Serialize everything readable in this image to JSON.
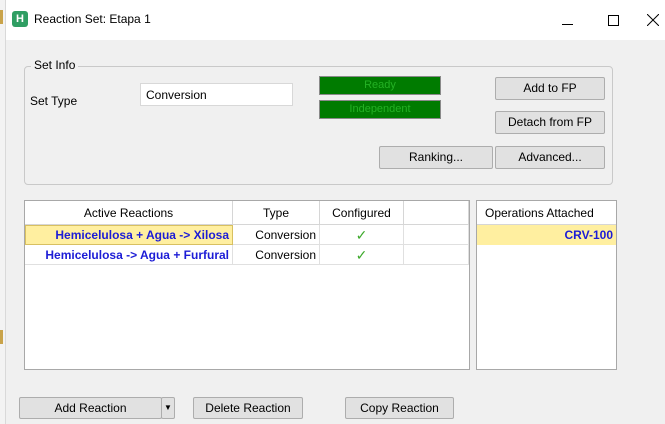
{
  "window": {
    "title": "Reaction Set: Etapa 1",
    "icon": "hysys-app-icon",
    "icon_letter": "H",
    "controls": [
      "minimize-icon",
      "maximize-icon",
      "close-icon"
    ]
  },
  "set_info": {
    "group_label": "Set Info",
    "set_type_label": "Set Type",
    "set_type_value": "Conversion",
    "status_ready": "Ready",
    "status_independent": "Independent",
    "buttons": {
      "add_to_fp": "Add to FP",
      "detach_from_fp": "Detach from FP",
      "ranking": "Ranking...",
      "advanced": "Advanced..."
    }
  },
  "reactions_table": {
    "headers": [
      "Active Reactions",
      "Type",
      "Configured",
      ""
    ],
    "rows": [
      {
        "name": "Hemicelulosa + Agua -> Xilosa",
        "type": "Conversion",
        "configured": "✓"
      },
      {
        "name": "Hemicelulosa -> Agua + Furfural",
        "type": "Conversion",
        "configured": "✓"
      }
    ]
  },
  "operations": {
    "header": "Operations Attached",
    "items": [
      "CRV-100"
    ]
  },
  "bottom_buttons": {
    "add_reaction": "Add Reaction",
    "dropdown_glyph": "▼",
    "delete_reaction": "Delete Reaction",
    "copy_reaction": "Copy Reaction"
  },
  "colors": {
    "status_bg": "#007b00",
    "status_text": "#24b124",
    "selection": "#ffefa0",
    "reaction_text": "#1c1cd6",
    "check": "#3faa2e"
  }
}
